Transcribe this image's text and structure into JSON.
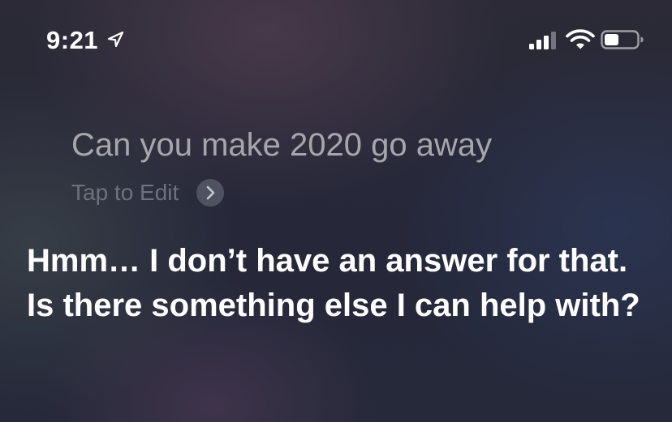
{
  "status_bar": {
    "time": "9:21",
    "location_icon": "location-arrow-icon",
    "signal_icon": "cellular-signal-icon",
    "wifi_icon": "wifi-icon",
    "battery_icon": "battery-icon",
    "battery_level": 0.45
  },
  "siri": {
    "query": "Can you make 2020 go away",
    "tap_to_edit_label": "Tap to Edit",
    "edit_chevron_icon": "chevron-right-icon",
    "response": "Hmm… I don’t have an answer for that. Is there something else I can help with?"
  },
  "colors": {
    "query_text": "#a6a6ad",
    "tap_to_edit_text": "#6f717b",
    "response_text": "#ffffff",
    "chevron_background": "#4f5260"
  }
}
